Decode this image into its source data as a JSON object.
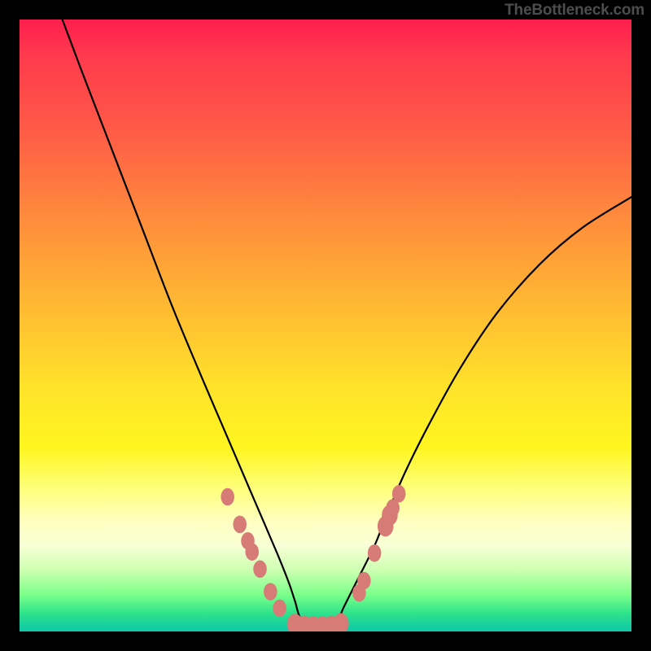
{
  "attribution": "TheBottleneck.com",
  "colors": {
    "marker": "#d77b77",
    "curve": "#000000",
    "frame": "#000000"
  },
  "chart_data": {
    "type": "line",
    "title": "",
    "xlabel": "",
    "ylabel": "",
    "xlim": [
      0,
      100
    ],
    "ylim": [
      0,
      100
    ],
    "grid": false,
    "legend": false,
    "series": [
      {
        "name": "bottleneck-curve",
        "x": [
          7,
          10,
          15,
          20,
          25,
          30,
          33,
          36,
          39,
          42,
          44,
          45,
          46,
          48,
          50,
          52,
          53,
          55,
          58,
          60,
          63,
          67,
          72,
          78,
          85,
          92,
          100
        ],
        "y": [
          100,
          92,
          79,
          66,
          53,
          41,
          34,
          27,
          20,
          13,
          8,
          5,
          2,
          1,
          1,
          2,
          4,
          8,
          14,
          19,
          26,
          34,
          43,
          52,
          60,
          66,
          71
        ]
      }
    ],
    "markers": [
      {
        "x": 34.0,
        "y": 22.0,
        "r": 1.1
      },
      {
        "x": 36.0,
        "y": 17.5,
        "r": 1.1
      },
      {
        "x": 37.3,
        "y": 14.8,
        "r": 1.1
      },
      {
        "x": 38.0,
        "y": 13.0,
        "r": 1.1
      },
      {
        "x": 39.3,
        "y": 10.2,
        "r": 1.1
      },
      {
        "x": 41.0,
        "y": 6.5,
        "r": 1.1
      },
      {
        "x": 42.5,
        "y": 3.8,
        "r": 1.1
      },
      {
        "x": 45.0,
        "y": 1.2,
        "r": 1.3
      },
      {
        "x": 46.5,
        "y": 0.9,
        "r": 1.3
      },
      {
        "x": 48.0,
        "y": 0.8,
        "r": 1.3
      },
      {
        "x": 49.5,
        "y": 0.8,
        "r": 1.3
      },
      {
        "x": 51.0,
        "y": 0.9,
        "r": 1.3
      },
      {
        "x": 52.5,
        "y": 1.3,
        "r": 1.3
      },
      {
        "x": 55.5,
        "y": 6.3,
        "r": 1.1
      },
      {
        "x": 56.3,
        "y": 8.3,
        "r": 1.1
      },
      {
        "x": 58.0,
        "y": 12.8,
        "r": 1.1
      },
      {
        "x": 59.8,
        "y": 17.2,
        "r": 1.3
      },
      {
        "x": 60.5,
        "y": 19.0,
        "r": 1.3
      },
      {
        "x": 61.0,
        "y": 20.2,
        "r": 1.1
      },
      {
        "x": 62.0,
        "y": 22.5,
        "r": 1.1
      }
    ],
    "annotations": []
  }
}
